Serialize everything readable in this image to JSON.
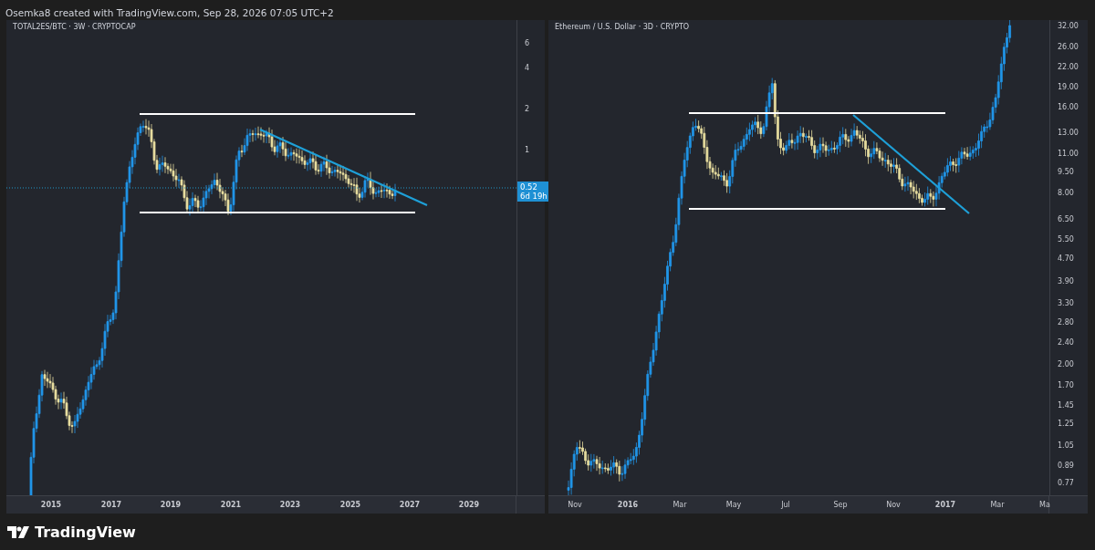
{
  "header": "Osemka8 created with TradingView.com, Sep 28, 2026 07:05 UTC+2",
  "charts": [
    {
      "title": "TOTAL2ES/BTC · 3W · CRYPTOCAP",
      "price_ticks": [
        "6",
        "4",
        "2",
        "1"
      ],
      "price_badge": {
        "price": "0.52",
        "countdown": "6d 19h"
      },
      "time_ticks": [
        {
          "label": "2015",
          "kind": "year"
        },
        {
          "label": "2017",
          "kind": "year"
        },
        {
          "label": "2019",
          "kind": "year"
        },
        {
          "label": "2021",
          "kind": "year"
        },
        {
          "label": "2023",
          "kind": "year"
        },
        {
          "label": "2025",
          "kind": "year"
        },
        {
          "label": "2027",
          "kind": "year"
        },
        {
          "label": "2029",
          "kind": "year"
        }
      ]
    },
    {
      "title": "Ethereum / U.S. Dollar · 3D · CRYPTO",
      "price_ticks": [
        "32.00",
        "26.00",
        "22.00",
        "19.00",
        "16.00",
        "13.00",
        "11.00",
        "9.50",
        "8.00",
        "6.50",
        "5.50",
        "4.70",
        "3.90",
        "3.30",
        "2.80",
        "2.40",
        "2.00",
        "1.70",
        "1.45",
        "1.25",
        "1.05",
        "0.89",
        "0.77"
      ],
      "time_ticks": [
        {
          "label": "Nov",
          "kind": "month"
        },
        {
          "label": "2016",
          "kind": "year"
        },
        {
          "label": "Mar",
          "kind": "month"
        },
        {
          "label": "May",
          "kind": "month"
        },
        {
          "label": "Jul",
          "kind": "month"
        },
        {
          "label": "Sep",
          "kind": "month"
        },
        {
          "label": "Nov",
          "kind": "month"
        },
        {
          "label": "2017",
          "kind": "year"
        },
        {
          "label": "Mar",
          "kind": "month"
        },
        {
          "label": "Ma",
          "kind": "month"
        }
      ]
    }
  ],
  "footer": {
    "logo_text": "TradingView"
  }
}
